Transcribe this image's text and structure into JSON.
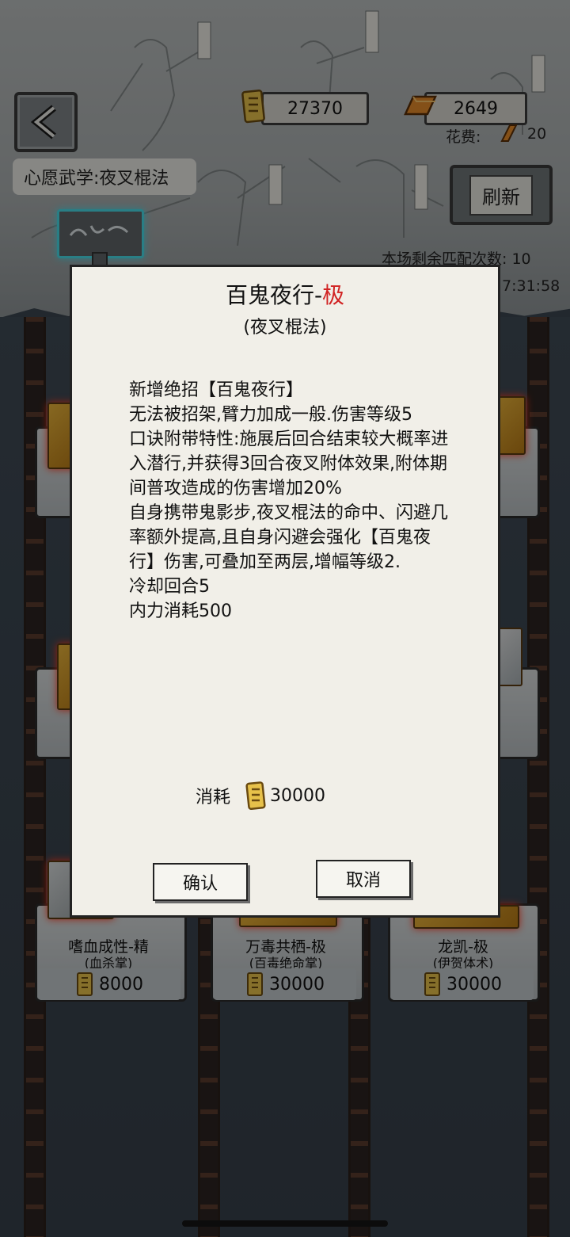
{
  "header": {
    "coins": "27370",
    "gold": "2649",
    "cost_label": "花费:",
    "cost_value": "20"
  },
  "wish": {
    "label": "心愿武学:夜叉棍法"
  },
  "refresh_label": "刷新",
  "matches_label": "本场剩余匹配次数: 10",
  "timer_fragment": "7:31:58",
  "shelf_items": [
    {
      "title": "嗜血成性-精",
      "subtitle": "(血杀掌)",
      "price": "8000"
    },
    {
      "title": "万毒共栖-极",
      "subtitle": "(百毒绝命掌)",
      "price": "30000"
    },
    {
      "title": "龙凯-极",
      "subtitle": "(伊贺体术)",
      "price": "30000"
    }
  ],
  "dialog": {
    "title_main": "百鬼夜行-",
    "title_grade": "极",
    "subtitle": "(夜叉棍法)",
    "lines": [
      "新增绝招【百鬼夜行】",
      "无法被招架,臂力加成一般.伤害等级5",
      "口诀附带特性:施展后回合结束较大概率进入潜行,并获得3回合夜叉附体效果,附体期间普攻造成的伤害增加20%",
      "自身携带鬼影步,夜叉棍法的命中、闪避几率额外提高,且自身闪避会强化【百鬼夜行】伤害,可叠加至两层,增幅等级2.",
      "冷却回合5",
      "内力消耗500"
    ],
    "consume_label": "消耗",
    "consume_value": "30000",
    "confirm_label": "确认",
    "cancel_label": "取消"
  },
  "colors": {
    "grade_red": "#d12323",
    "sign_glow": "#47d9e6"
  }
}
